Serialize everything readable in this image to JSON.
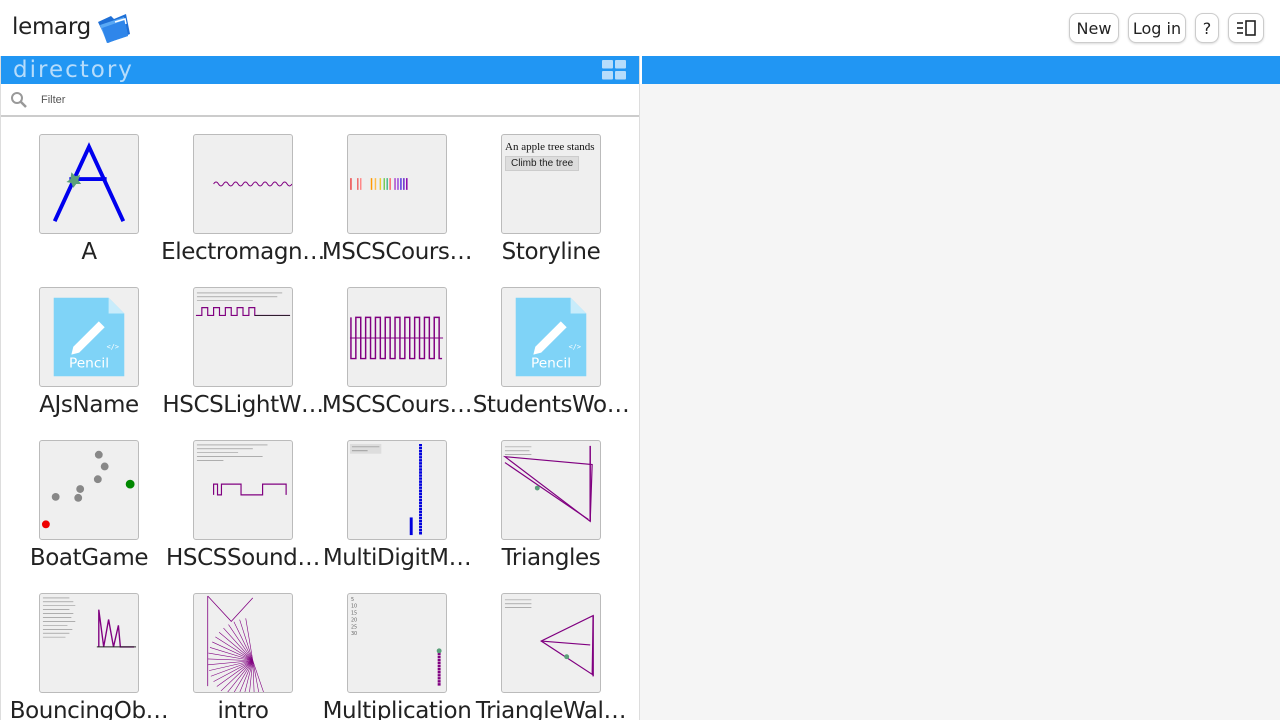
{
  "header": {
    "brand": "lemarg",
    "buttons": {
      "new": "New",
      "login": "Log in",
      "help": "?"
    }
  },
  "directory": {
    "title": "directory",
    "filter_placeholder": "Filter",
    "items": [
      {
        "name": "A"
      },
      {
        "name": "Electromagn…"
      },
      {
        "name": "MSCSCours…"
      },
      {
        "name": "Storyline",
        "preview_text": "An apple tree stands",
        "preview_button": "Climb the tree"
      },
      {
        "name": "AJsName",
        "preview_label": "Pencil"
      },
      {
        "name": "HSCSLightW…"
      },
      {
        "name": "MSCSCours…"
      },
      {
        "name": "StudentsWo…",
        "preview_label": "Pencil"
      },
      {
        "name": "BoatGame"
      },
      {
        "name": "HSCSSound…"
      },
      {
        "name": "MultiDigitM…"
      },
      {
        "name": "Triangles"
      },
      {
        "name": "BouncingOb…"
      },
      {
        "name": "intro"
      },
      {
        "name": "Multiplication"
      },
      {
        "name": "TriangleWal…"
      }
    ]
  },
  "colors": {
    "accent": "#2196f3",
    "purple": "#800080",
    "pencil": "#7fd3f7"
  }
}
